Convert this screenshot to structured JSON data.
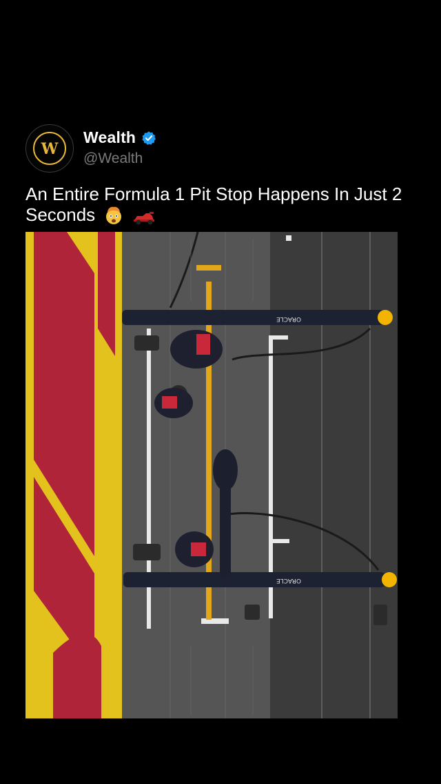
{
  "post": {
    "display_name": "Wealth",
    "handle": "@Wealth",
    "verified": true,
    "avatar_icon": "wealth-logo-icon",
    "caption": "An Entire Formula 1 Pit Stop Happens In Just 2 Seconds",
    "caption_emojis": [
      "exploding-head-emoji",
      "racing-car-emoji"
    ]
  },
  "media": {
    "description_icon": "pit-stop-aerial-photo",
    "pitwall_logo_top": "ORACLE",
    "pitwall_logo_bottom": "ORACLE"
  },
  "colors": {
    "background": "#000000",
    "handle": "#7a7a7a",
    "verified": "#1d9bf0",
    "logo_gold": "#e8b73a",
    "track_yellow": "#e4c21e",
    "track_red": "#b0243a"
  }
}
